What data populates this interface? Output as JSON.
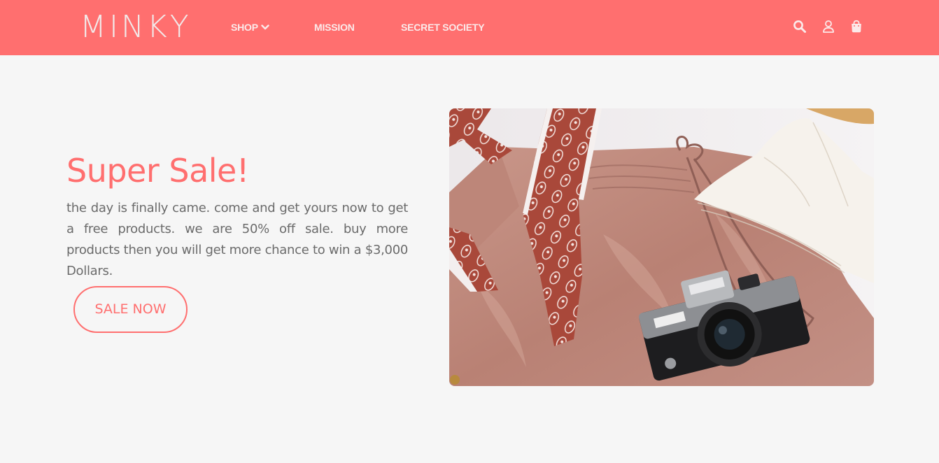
{
  "header": {
    "logo": "MINKY",
    "nav": [
      {
        "label": "SHOP"
      },
      {
        "label": "MISSION"
      },
      {
        "label": "SECRET SOCIETY"
      }
    ],
    "icons": [
      "search-icon",
      "user-icon",
      "shopping-bag-icon"
    ]
  },
  "hero": {
    "title": "Super Sale!",
    "text": "the day is finally came. come and get yours now to get a free products. we are 50% off sale. buy more products then you will get more chance to win a $3,000 Dollars.",
    "button_label": "SALE NOW",
    "image_semantic": "flat-lay-clothes-camera-image"
  },
  "colors": {
    "accent": "#ff6f6f",
    "background": "#f6f6f6",
    "text": "#6b6b6b"
  }
}
